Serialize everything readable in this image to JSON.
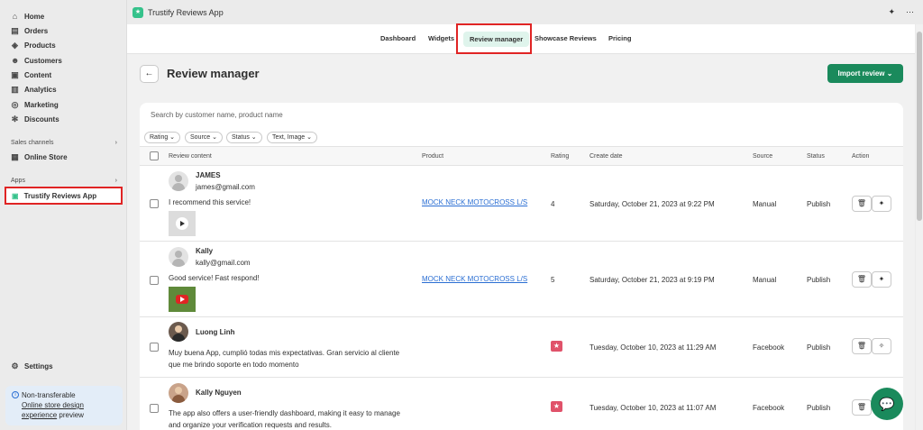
{
  "sidebar": {
    "items": [
      {
        "label": "Home",
        "icon": "home-icon",
        "glyph": "⌂"
      },
      {
        "label": "Orders",
        "icon": "orders-icon",
        "glyph": "▤"
      },
      {
        "label": "Products",
        "icon": "products-icon",
        "glyph": "◈"
      },
      {
        "label": "Customers",
        "icon": "customers-icon",
        "glyph": "☻"
      },
      {
        "label": "Content",
        "icon": "content-icon",
        "glyph": "▣"
      },
      {
        "label": "Analytics",
        "icon": "analytics-icon",
        "glyph": "▥"
      },
      {
        "label": "Marketing",
        "icon": "marketing-icon",
        "glyph": "◎"
      },
      {
        "label": "Discounts",
        "icon": "discounts-icon",
        "glyph": "✻"
      }
    ],
    "sales_channels_label": "Sales channels",
    "online_store": "Online Store",
    "apps_label": "Apps",
    "app_item": "Trustify Reviews App",
    "settings": "Settings",
    "promo": {
      "line1": "Non-transferable",
      "link": "Online store design experience",
      "suffix": "preview"
    }
  },
  "topbar": {
    "app_title": "Trustify Reviews App"
  },
  "tabs": {
    "dashboard": "Dashboard",
    "widgets": "Widgets",
    "review_manager": "Review manager",
    "showcase": "Showcase Reviews",
    "pricing": "Pricing"
  },
  "page": {
    "title": "Review manager",
    "import_label": "Import review ⌄"
  },
  "search": {
    "placeholder": "Search by customer name, product name"
  },
  "filters": {
    "rating": "Rating ⌄",
    "source": "Source ⌄",
    "status": "Status ⌄",
    "type": "Text, Image ⌄"
  },
  "columns": {
    "review_content": "Review content",
    "product": "Product",
    "rating": "Rating",
    "create_date": "Create date",
    "source": "Source",
    "status": "Status",
    "action": "Action"
  },
  "rows": [
    {
      "name": "JAMES",
      "email": "james@gmail.com",
      "message": "I recommend this service!",
      "product": "MOCK NECK MOTOCROSS L/S",
      "rating": "4",
      "date": "Saturday, October 21, 2023 at 9:22 PM",
      "source": "Manual",
      "status": "Publish"
    },
    {
      "name": "Kally",
      "email": "kally@gmail.com",
      "message": "Good service! Fast respond!",
      "product": "MOCK NECK MOTOCROSS L/S",
      "rating": "5",
      "date": "Saturday, October 21, 2023 at 9:19 PM",
      "source": "Manual",
      "status": "Publish"
    },
    {
      "name": "Luong Linh",
      "message": "Muy buena App, cumplió todas mis expectativas. Gran servicio al cliente que me brindo soporte en todo momento",
      "date": "Tuesday, October 10, 2023 at 11:29 AM",
      "source": "Facebook",
      "status": "Publish"
    },
    {
      "name": "Kally Nguyen",
      "message": "The app also offers a user-friendly dashboard, making it easy to manage and organize your verification requests and results.",
      "date": "Tuesday, October 10, 2023 at 11:07 AM",
      "source": "Facebook",
      "status": "Publish"
    }
  ],
  "colors": {
    "accent": "#1a8a5c",
    "highlight": "#e02424",
    "link": "#2a6ed3"
  }
}
